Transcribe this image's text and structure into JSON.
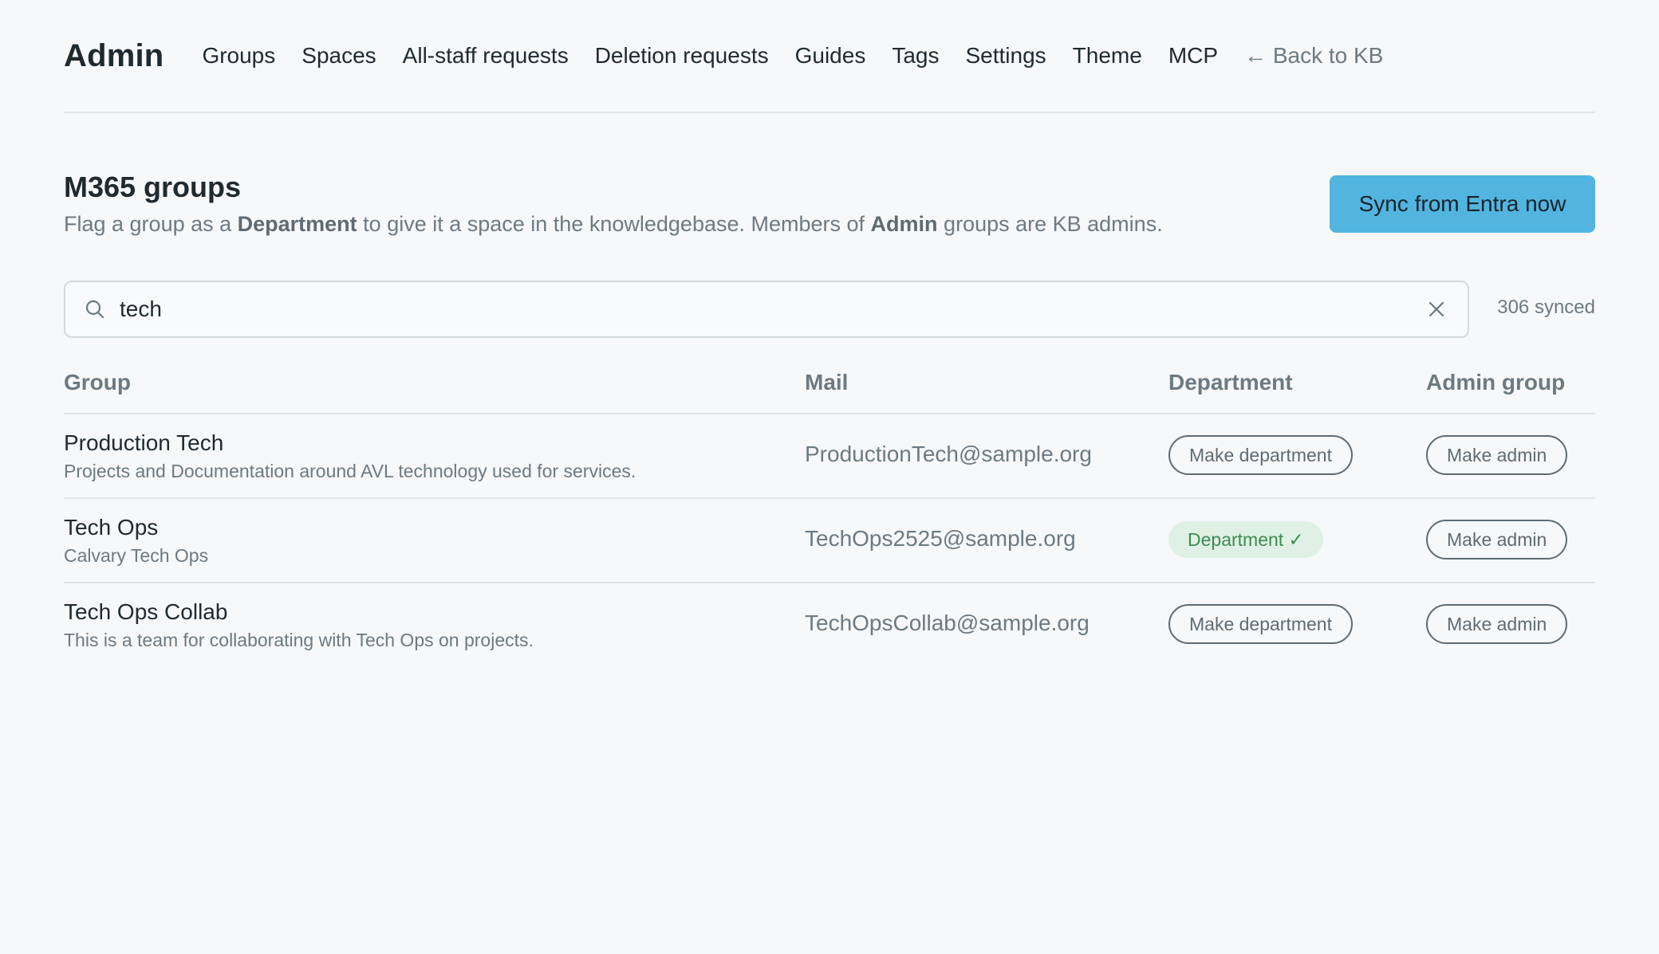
{
  "header": {
    "brand": "Admin",
    "nav": [
      "Groups",
      "Spaces",
      "All-staff requests",
      "Deletion requests",
      "Guides",
      "Tags",
      "Settings",
      "Theme",
      "MCP"
    ],
    "back_link": "← Back to KB"
  },
  "section": {
    "title": "M365 groups",
    "desc_part1": "Flag a group as a ",
    "desc_bold1": "Department",
    "desc_part2": " to give it a space in the knowledgebase. Members of ",
    "desc_bold2": "Admin",
    "desc_part3": " groups are KB admins.",
    "sync_button": "Sync from Entra now"
  },
  "search": {
    "value": "tech",
    "synced_count": "306 synced"
  },
  "table": {
    "columns": [
      "Group",
      "Mail",
      "Department",
      "Admin group"
    ],
    "rows": [
      {
        "name": "Production Tech",
        "desc": "Projects and Documentation around AVL technology used for services.",
        "mail": "ProductionTech@sample.org",
        "department": "Make department",
        "is_department": false,
        "admin": "Make admin"
      },
      {
        "name": "Tech Ops",
        "desc": "Calvary Tech Ops",
        "mail": "TechOps2525@sample.org",
        "department": "Department ✓",
        "is_department": true,
        "admin": "Make admin"
      },
      {
        "name": "Tech Ops Collab",
        "desc": "This is a team for collaborating with Tech Ops on projects.",
        "mail": "TechOpsCollab@sample.org",
        "department": "Make department",
        "is_department": false,
        "admin": "Make admin"
      }
    ]
  },
  "colors": {
    "accent": "#52b5e0",
    "department_badge_bg": "#dff1e4",
    "department_badge_text": "#3f8a52"
  }
}
